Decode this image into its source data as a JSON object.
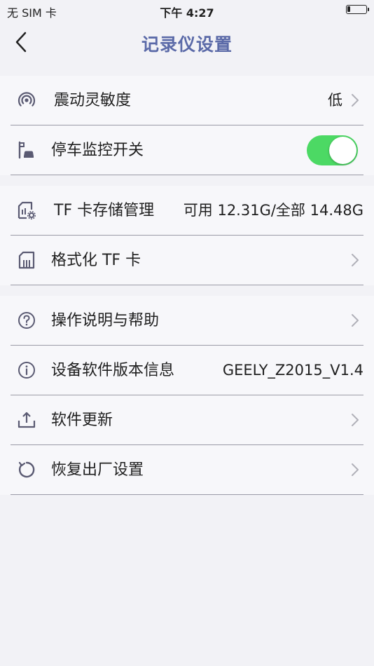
{
  "status_bar": {
    "carrier": "无 SIM 卡",
    "time": "下午 4:27",
    "battery_icon": "battery-low-icon"
  },
  "nav": {
    "title": "记录仪设置",
    "back_icon": "chevron-left-icon"
  },
  "sections": [
    {
      "rows": [
        {
          "icon": "vibration-signal-icon",
          "label": "震动灵敏度",
          "value": "低",
          "chevron": true
        },
        {
          "icon": "parking-car-icon",
          "label": "停车监控开关",
          "toggle": true,
          "toggle_on": true
        }
      ]
    },
    {
      "rows": [
        {
          "icon": "sd-card-settings-icon",
          "label": "TF 卡存储管理",
          "value": "可用 12.31G/全部 14.48G",
          "chevron": false
        },
        {
          "icon": "sd-card-icon",
          "label": "格式化 TF 卡",
          "chevron": true
        }
      ]
    },
    {
      "rows": [
        {
          "icon": "question-circle-icon",
          "label": "操作说明与帮助",
          "chevron": true
        },
        {
          "icon": "info-circle-icon",
          "label": "设备软件版本信息",
          "value": "GEELY_Z2015_V1.4",
          "chevron": false
        },
        {
          "icon": "upload-icon",
          "label": "软件更新",
          "chevron": true
        },
        {
          "icon": "reset-icon",
          "label": "恢复出厂设置",
          "chevron": true
        }
      ]
    }
  ],
  "colors": {
    "accent": "#5b6aa8",
    "icon": "#5a5a72",
    "toggle_on": "#4cd964",
    "background": "#f2f2f6"
  }
}
